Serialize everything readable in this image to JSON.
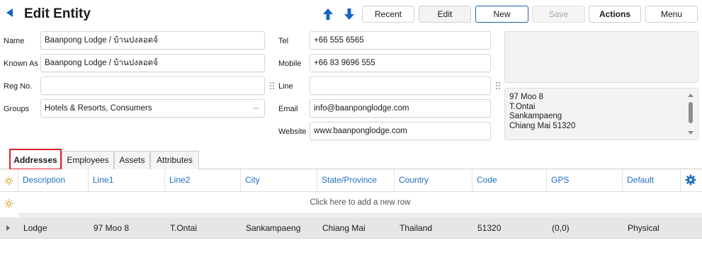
{
  "header": {
    "title": "Edit Entity",
    "buttons": {
      "recent": "Recent",
      "edit": "Edit",
      "new": "New",
      "save": "Save",
      "actions": "Actions",
      "menu": "Menu"
    }
  },
  "form": {
    "name": {
      "label": "Name",
      "value": "Baanpong Lodge / บ้านปงลอดจ์"
    },
    "known_as": {
      "label": "Known As",
      "value": "Baanpong Lodge / บ้านปงลอดจ์"
    },
    "reg_no": {
      "label": "Reg No.",
      "value": ""
    },
    "groups": {
      "label": "Groups",
      "value": "Hotels & Resorts, Consumers",
      "more": "···"
    },
    "tel": {
      "label": "Tel",
      "value": "+66 555 6565"
    },
    "mobile": {
      "label": "Mobile",
      "value": "+66 83  9696 555"
    },
    "line": {
      "label": "Line",
      "value": ""
    },
    "email": {
      "label": "Email",
      "value": "info@baanponglodge.com"
    },
    "website": {
      "label": "Website",
      "value": "www.baanponglodge.com"
    },
    "address_preview": [
      "97 Moo 8",
      "T.Ontai",
      "Sankampaeng",
      "Chiang Mai 51320"
    ]
  },
  "tabs": [
    {
      "label": "Addresses",
      "active": true
    },
    {
      "label": "Employees",
      "active": false
    },
    {
      "label": "Assets",
      "active": false
    },
    {
      "label": "Attributes",
      "active": false
    }
  ],
  "grid": {
    "columns": [
      "Description",
      "Line1",
      "Line2",
      "City",
      "State/Province",
      "Country",
      "Code",
      "GPS",
      "Default"
    ],
    "add_row_text": "Click here to add a new row",
    "rows": [
      [
        "Lodge",
        "97 Moo 8",
        "T.Ontai",
        "Sankampaeng",
        "Chiang Mai",
        "Thailand",
        "51320",
        "(0,0)",
        "Physical"
      ]
    ]
  },
  "colors": {
    "accent": "#1565c0",
    "header_text": "#1f6fbf",
    "active_tab_border": "#d9232d",
    "row_bg": "#e6e6e6"
  }
}
